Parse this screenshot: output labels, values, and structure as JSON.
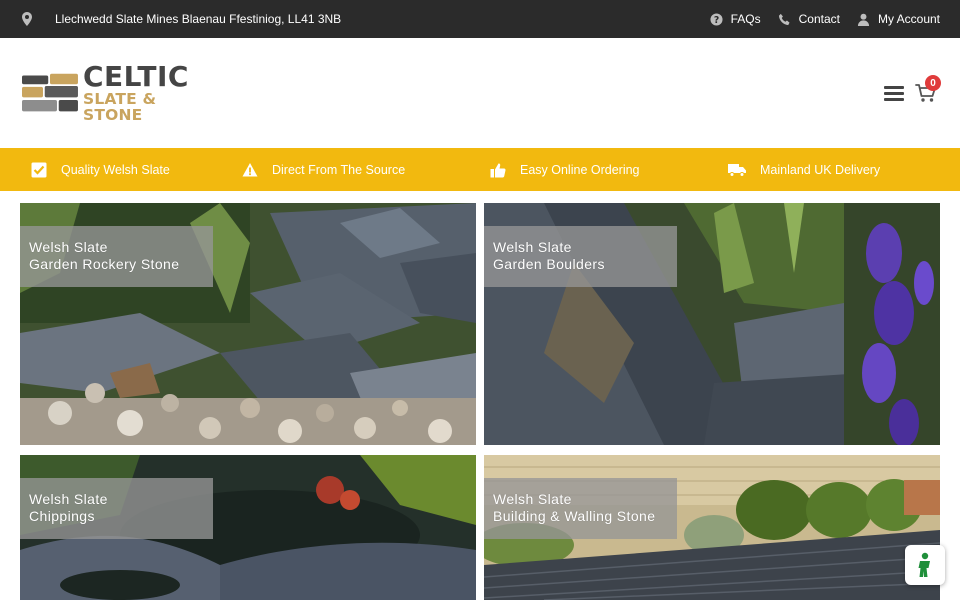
{
  "topbar": {
    "address": "Llechwedd Slate Mines Blaenau Ffestiniog, LL41 3NB",
    "links": [
      {
        "label": "FAQs",
        "icon": "question-circle-icon"
      },
      {
        "label": "Contact",
        "icon": "phone-icon"
      },
      {
        "label": "My Account",
        "icon": "user-icon"
      }
    ]
  },
  "header": {
    "logo_line1": "CELTIC",
    "logo_line2": "SLATE & STONE",
    "cart_count": "0"
  },
  "features": [
    {
      "label": "Quality Welsh Slate",
      "icon": "checkbox-icon"
    },
    {
      "label": "Direct From The Source",
      "icon": "warning-triangle-icon"
    },
    {
      "label": "Easy Online Ordering",
      "icon": "thumbs-up-icon"
    },
    {
      "label": "Mainland UK Delivery",
      "icon": "truck-icon"
    }
  ],
  "tiles": [
    {
      "line1": "Welsh Slate",
      "line2": "Garden Rockery Stone"
    },
    {
      "line1": "Welsh Slate",
      "line2": "Garden Boulders"
    },
    {
      "line1": "Welsh Slate",
      "line2": "Chippings"
    },
    {
      "line1": "Welsh Slate",
      "line2": "Building & Walling Stone"
    }
  ],
  "colors": {
    "topbar_bg": "#2b2b2b",
    "feature_bar_bg": "#f2b90f",
    "logo_gold": "#c9a45e",
    "badge_red": "#e03b3b"
  }
}
